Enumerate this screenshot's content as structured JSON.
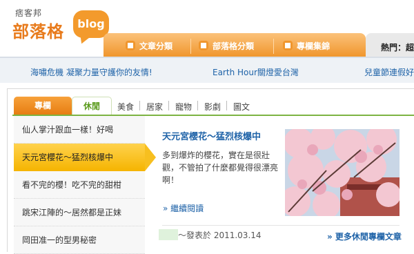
{
  "brand": {
    "small": "痞客邦",
    "big": "部落格",
    "bubble": "blog"
  },
  "nav": {
    "tabs": [
      {
        "label": "文章分類",
        "icon": "document-icon"
      },
      {
        "label": "部落格分類",
        "icon": "globe-icon"
      },
      {
        "label": "專欄集錦",
        "icon": "book-icon"
      }
    ],
    "hot_label": "熱門：超級"
  },
  "ticker": [
    "海嘯危機 凝聚力量守護你的友情!",
    "Earth Hour關燈愛台灣",
    "兒童節連假好"
  ],
  "main_tabs": {
    "primary": "專欄",
    "active": "休閒",
    "subs": [
      "美食",
      "居家",
      "寵物",
      "影劇",
      "圖文"
    ]
  },
  "list": [
    "仙人掌汁跟血一樣！好喝",
    "天元宮櫻花～猛烈核爆中",
    "看不完的櫻！吃不完的甜柑",
    "跳宋江陣的～居然都是正妹",
    "岡田准一的型男秘密"
  ],
  "article": {
    "title": "天元宮櫻花～猛烈核爆中",
    "body": "多到爆炸的櫻花，實在是很壯觀，不管拍了什麼都覺得很漂亮啊！",
    "more": "» 繼續閱讀"
  },
  "footer": {
    "posted": "～發表於 2011.03.14",
    "more": "» 更多休閒專欄文章"
  },
  "colors": {
    "orange": "#f0962d",
    "green": "#7cb342",
    "link": "#1f63a8",
    "active_yellow": "#f5b400"
  }
}
